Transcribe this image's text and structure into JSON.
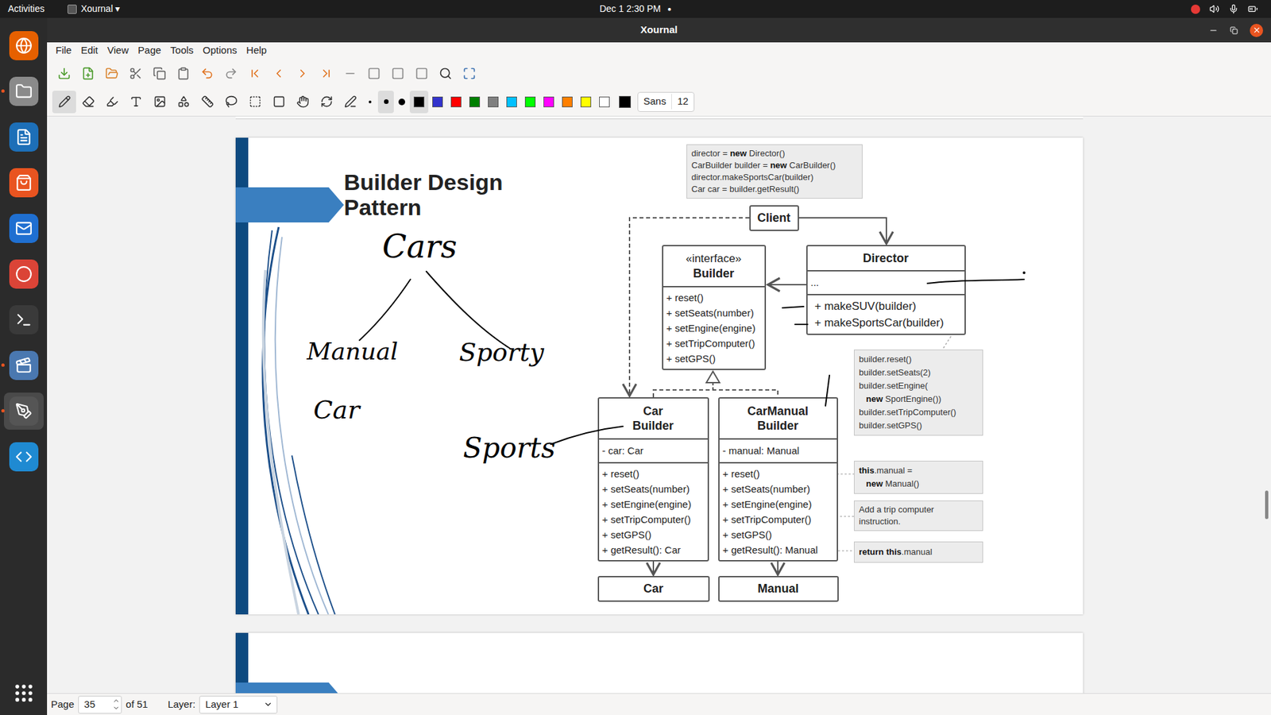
{
  "top_bar": {
    "activities": "Activities",
    "app": "Xournal ▾",
    "clock": "Dec 1  2:30 PM",
    "indicator": "●"
  },
  "dock": [
    {
      "running": false,
      "active": false
    },
    {
      "running": true,
      "active": false
    },
    {
      "running": false,
      "active": false
    },
    {
      "running": false,
      "active": false
    },
    {
      "running": false,
      "active": false
    },
    {
      "running": false,
      "active": false
    },
    {
      "running": false,
      "active": false
    },
    {
      "running": true,
      "active": false
    },
    {
      "running": true,
      "active": true
    },
    {
      "running": false,
      "active": false
    }
  ],
  "window": {
    "title": "Xournal"
  },
  "menu": [
    "File",
    "Edit",
    "View",
    "Page",
    "Tools",
    "Options",
    "Help"
  ],
  "tools": [
    {
      "selected": true
    },
    {
      "selected": false
    },
    {
      "selected": false
    },
    {
      "selected": false
    },
    {
      "selected": false
    },
    {
      "selected": false
    },
    {
      "selected": false
    },
    {
      "selected": false
    },
    {
      "selected": false
    },
    {
      "selected": false
    },
    {
      "selected": false
    },
    {
      "selected": false
    },
    {
      "selected": false
    }
  ],
  "pen_sizes": [
    {
      "selected": false
    },
    {
      "selected": true
    },
    {
      "selected": false
    }
  ],
  "colors": [
    {
      "color": "#000000",
      "selected": true
    },
    {
      "color": "#3333cc",
      "selected": false
    },
    {
      "color": "#ff0000",
      "selected": false
    },
    {
      "color": "#008000",
      "selected": false
    },
    {
      "color": "#808080",
      "selected": false
    },
    {
      "color": "#00c0ff",
      "selected": false
    },
    {
      "color": "#00ff00",
      "selected": false
    },
    {
      "color": "#ff00ff",
      "selected": false
    },
    {
      "color": "#ff8000",
      "selected": false
    },
    {
      "color": "#ffff00",
      "selected": false
    },
    {
      "color": "#ffffff",
      "selected": false
    }
  ],
  "current_color": "#000000",
  "font": {
    "name": "Sans",
    "size": "12"
  },
  "page": {
    "title": "Builder Design Pattern",
    "handwriting": [
      "Cars",
      "Manual",
      "Sporty",
      "Car",
      "Sports"
    ],
    "client_note": [
      [
        {
          "t": "director = ",
          "b": false
        },
        {
          "t": "new",
          "b": true
        },
        {
          "t": " Director()",
          "b": false
        }
      ],
      [
        {
          "t": "CarBuilder builder = ",
          "b": false
        },
        {
          "t": "new",
          "b": true
        },
        {
          "t": " CarBuilder()",
          "b": false
        }
      ],
      [
        {
          "t": "director.makeSportsCar(builder)",
          "b": false
        }
      ],
      [
        {
          "t": "Car car = builder.getResult()",
          "b": false
        }
      ]
    ],
    "client": "Client",
    "builder": {
      "stereotype": "«interface»",
      "name": "Builder",
      "methods": [
        "+ reset()",
        "+ setSeats(number)",
        "+ setEngine(engine)",
        "+ setTripComputer()",
        "+ setGPS()"
      ]
    },
    "director": {
      "name": "Director",
      "field": "...",
      "methods": [
        "+ makeSUV(builder)",
        "+ makeSportsCar(builder)"
      ]
    },
    "director_note": [
      [
        {
          "t": "builder.reset()",
          "b": false
        }
      ],
      [
        {
          "t": "builder.setSeats(2)",
          "b": false
        }
      ],
      [
        {
          "t": "builder.setEngine(",
          "b": false
        }
      ],
      [
        {
          "t": "   ",
          "b": false
        },
        {
          "t": "new",
          "b": true
        },
        {
          "t": " SportEngine())",
          "b": false
        }
      ],
      [
        {
          "t": "builder.setTripComputer()",
          "b": false
        }
      ],
      [
        {
          "t": "builder.setGPS()",
          "b": false
        }
      ]
    ],
    "car_builder": {
      "name": "Car Builder",
      "field": "- car: Car",
      "methods": [
        "+ reset()",
        "+ setSeats(number)",
        "+ setEngine(engine)",
        "+ setTripComputer()",
        "+ setGPS()",
        "+ getResult(): Car"
      ]
    },
    "manual_builder": {
      "name": "CarManual Builder",
      "field": "- manual: Manual",
      "methods": [
        "+ reset()",
        "+ setSeats(number)",
        "+ setEngine(engine)",
        "+ setTripComputer()",
        "+ setGPS()",
        "+ getResult(): Manual"
      ]
    },
    "products": [
      "Car",
      "Manual"
    ],
    "notes": [
      [
        [
          {
            "t": "this",
            "b": true
          },
          {
            "t": ".manual =",
            "b": false
          }
        ],
        [
          {
            "t": "   ",
            "b": false
          },
          {
            "t": "new",
            "b": true
          },
          {
            "t": " Manual()",
            "b": false
          }
        ]
      ],
      [
        [
          {
            "t": "Add a trip computer",
            "b": false
          }
        ],
        [
          {
            "t": "instruction.",
            "b": false
          }
        ]
      ],
      [
        [
          {
            "t": "return this",
            "b": true
          },
          {
            "t": ".manual",
            "b": false
          }
        ]
      ]
    ]
  },
  "status": {
    "page_label": "Page",
    "page": "35",
    "of": "of 51",
    "layer_label": "Layer:",
    "layer": "Layer 1"
  }
}
